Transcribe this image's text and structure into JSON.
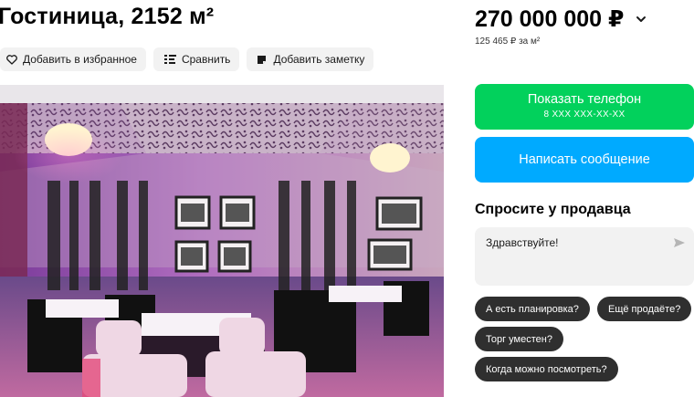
{
  "listing": {
    "title": "Гостиница, 2152 м²",
    "favorite_label": "Добавить в избранное",
    "compare_label": "Сравнить",
    "note_label": "Добавить заметку"
  },
  "icons": {
    "favorite": "heart-icon",
    "compare": "compare-icon",
    "note": "note-icon",
    "price_toggle": "chevron-down-icon",
    "send": "send-icon"
  },
  "price": {
    "total": "270 000 000 ₽",
    "per_meter": "125 465 ₽ за м²"
  },
  "contact": {
    "phone_label": "Показать телефон",
    "phone_masked": "8 XXX XXX-XX-XX",
    "message_label": "Написать сообщение"
  },
  "ask": {
    "title": "Спросите у продавца",
    "message_value": "Здравствуйте!",
    "chips": [
      "А есть планировка?",
      "Ещё продаёте?",
      "Торг уместен?",
      "Когда можно посмотреть?"
    ]
  },
  "colors": {
    "phone_button": "#02d15c",
    "message_button": "#00aaff",
    "chip": "#2f2f2f"
  }
}
